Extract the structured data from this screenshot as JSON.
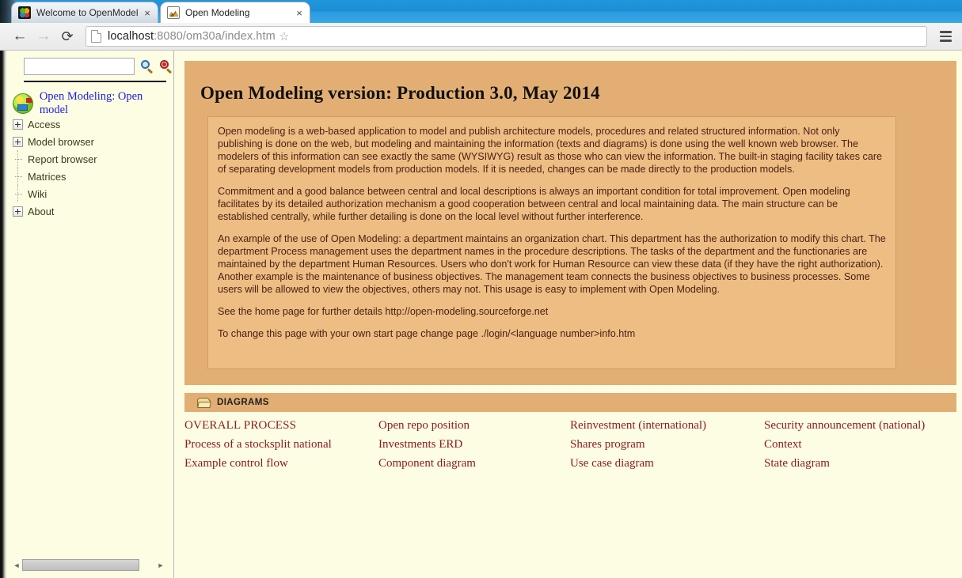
{
  "browser": {
    "tabs": [
      {
        "title": "Welcome to OpenModeli",
        "icon": "joomla-favicon",
        "close_label": "×",
        "active": false
      },
      {
        "title": "Open Modeling",
        "icon": "open-modeling-favicon",
        "close_label": "×",
        "active": true
      }
    ],
    "toolbar": {
      "back_glyph": "←",
      "forward_glyph": "→",
      "reload_glyph": "⟳",
      "url_host": "localhost",
      "url_rest": ":8080/om30a/index.htm",
      "url_full": "localhost:8080/om30a/index.htm",
      "star_glyph": "☆",
      "menu_label": "menu"
    }
  },
  "sidebar": {
    "search": {
      "value": "",
      "placeholder": ""
    },
    "search_icon_label": "search",
    "search_clear_icon_label": "search-remove",
    "root": {
      "label": "Open Modeling: Open model"
    },
    "tree": [
      {
        "label": "Access",
        "type": "expandable"
      },
      {
        "label": "Model browser",
        "type": "expandable"
      },
      {
        "label": "Report browser",
        "type": "leaf"
      },
      {
        "label": "Matrices",
        "type": "leaf"
      },
      {
        "label": "Wiki",
        "type": "leaf"
      },
      {
        "label": "About",
        "type": "expandable"
      }
    ],
    "scroll": {
      "left_arrow": "◄",
      "right_arrow": "►"
    }
  },
  "main": {
    "title": "Open Modeling version: Production 3.0, May 2014",
    "paragraphs": [
      "Open modeling is a web-based application to model and publish architecture models, procedures and related structured information. Not only publishing is done on the web, but modeling and maintaining the information (texts and diagrams) is done using the well known web browser. The modelers of this information can see exactly the same (WYSIWYG) result as those who can view the information. The built-in staging facility takes care of separating development models from production models. If it is needed, changes can be made directly to the production models.",
      "Commitment and a good balance between central and local descriptions is always an important condition for total improvement. Open modeling facilitates by its detailed authorization mechanism a good cooperation between central and local maintaining data. The main structure can be established centrally, while further detailing is done on the local level without further interference.",
      "An example of the use of Open Modeling: a department maintains an organization chart. This department has the authorization to modify this chart. The department Process management uses the department names in the procedure descriptions. The tasks of the department and the functionaries are maintained by the department Human Resources. Users who don't work for Human Resource can view these data (if they have the right authorization).",
      "Another example is the maintenance of business objectives. The management team connects the business objectives to business processes. Some users will be allowed to view the objectives, others may not. This usage is easy to implement with Open Modeling.",
      "See the home page for further details http://open-modeling.sourceforge.net",
      "To change this page with your own start page change page ./login/<language number>info.htm"
    ],
    "diagrams_section": {
      "title": "DIAGRAMS",
      "folder_icon_label": "folder-open-icon",
      "items": [
        "OVERALL PROCESS",
        "Open repo position",
        "Reinvestment (international)",
        "Security announcement (national)",
        "Process of a stocksplit national",
        "Investments ERD",
        "Shares program",
        "Context",
        "Example control flow",
        "Component diagram",
        "Use case diagram",
        "State diagram"
      ]
    }
  },
  "colors": {
    "panel_tan": "#e2ae74",
    "panel_inner": "#edbd84",
    "page_cream": "#fdfde4",
    "link_maroon": "#8b1a1a",
    "body_text": "#4a2112",
    "tree_link_blue": "#2020dd",
    "titlebar_blue": "#2196dd"
  }
}
